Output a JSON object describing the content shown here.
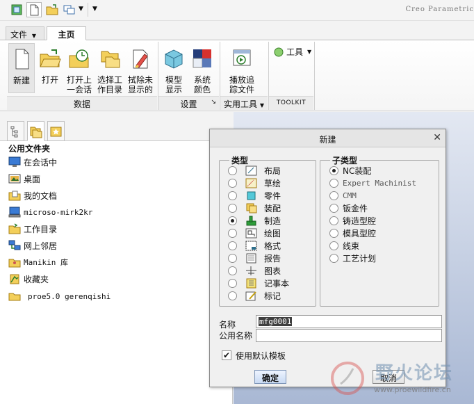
{
  "app_title": "Creo Parametric",
  "tabs": [
    {
      "label": "文件",
      "has_dropdown": true
    },
    {
      "label": "主页",
      "active": true
    }
  ],
  "ribbon": {
    "buttons": [
      {
        "label": "新建",
        "icon": "new-file-icon"
      },
      {
        "label": "打开",
        "icon": "open-folder-icon"
      },
      {
        "label": "打开上\n一会话",
        "icon": "open-last-session-icon"
      },
      {
        "label": "选择工\n作目录",
        "icon": "select-working-directory-icon"
      },
      {
        "label": "拭除未\n显示的",
        "icon": "erase-not-displayed-icon"
      },
      {
        "label": "模型\n显示",
        "icon": "model-display-icon"
      },
      {
        "label": "系统\n颜色",
        "icon": "system-colors-icon"
      },
      {
        "label": "播放追\n踪文件",
        "icon": "play-trail-file-icon"
      }
    ],
    "tools_label": "工具",
    "groups": [
      {
        "label": "数据"
      },
      {
        "label": "设置"
      },
      {
        "label": "实用工具"
      },
      {
        "label": "TOOLKIT"
      }
    ]
  },
  "left_panel": {
    "header": "公用文件夹",
    "items": [
      {
        "label": "在会话中",
        "icon": "in-session-icon"
      },
      {
        "label": "桌面",
        "icon": "desktop-icon"
      },
      {
        "label": "我的文档",
        "icon": "my-documents-icon"
      },
      {
        "label": "microso-mirk2kr",
        "icon": "computer-icon"
      },
      {
        "label": "工作目录",
        "icon": "working-directory-icon"
      },
      {
        "label": "网上邻居",
        "icon": "network-icon"
      },
      {
        "label": "Manikin 库",
        "icon": "manikin-library-icon"
      },
      {
        "label": "收藏夹",
        "icon": "favorites-icon"
      },
      {
        "label": "proe5.0 gerenqishi",
        "icon": "folder-icon"
      }
    ]
  },
  "dialog": {
    "title": "新建",
    "type_group_label": "类型",
    "types": [
      {
        "label": "布局",
        "icon": "layout-icon",
        "checked": false
      },
      {
        "label": "草绘",
        "icon": "sketch-icon",
        "checked": false
      },
      {
        "label": "零件",
        "icon": "part-icon",
        "checked": false
      },
      {
        "label": "装配",
        "icon": "assembly-icon",
        "checked": false
      },
      {
        "label": "制造",
        "icon": "manufacturing-icon",
        "checked": true
      },
      {
        "label": "绘图",
        "icon": "drawing-icon",
        "checked": false
      },
      {
        "label": "格式",
        "icon": "format-icon",
        "checked": false
      },
      {
        "label": "报告",
        "icon": "report-icon",
        "checked": false
      },
      {
        "label": "图表",
        "icon": "diagram-icon",
        "checked": false
      },
      {
        "label": "记事本",
        "icon": "notebook-icon",
        "checked": false
      },
      {
        "label": "标记",
        "icon": "markup-icon",
        "checked": false
      }
    ],
    "subtype_group_label": "子类型",
    "subtypes": [
      {
        "label": "NC装配",
        "checked": true
      },
      {
        "label": "Expert Machinist",
        "checked": false
      },
      {
        "label": "CMM",
        "checked": false
      },
      {
        "label": "钣金件",
        "checked": false
      },
      {
        "label": "铸造型腔",
        "checked": false
      },
      {
        "label": "模具型腔",
        "checked": false
      },
      {
        "label": "线束",
        "checked": false
      },
      {
        "label": "工艺计划",
        "checked": false
      }
    ],
    "name_label": "名称",
    "name_value": "mfg0001",
    "common_name_label": "公用名称",
    "common_name_value": "",
    "use_default_template_label": "使用默认模板",
    "use_default_template_checked": true,
    "ok_label": "确定",
    "cancel_label": "取消"
  },
  "watermark": {
    "text": "野火论坛",
    "url": "www.proewildfire.cn"
  }
}
